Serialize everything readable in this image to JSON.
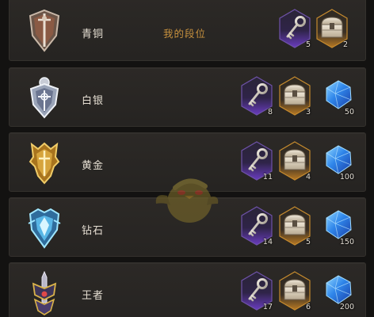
{
  "screen": {
    "my_tier_label": "我的段位"
  },
  "tiers": [
    {
      "name": "青铜",
      "emblem_icon": "bronze-shield-emblem",
      "rewards": [
        {
          "type": "key",
          "icon": "key-icon",
          "count": "5",
          "frame": "purple"
        },
        {
          "type": "chest",
          "icon": "chest-icon",
          "count": "2",
          "frame": "gold"
        }
      ]
    },
    {
      "name": "白银",
      "emblem_icon": "silver-shield-emblem",
      "rewards": [
        {
          "type": "key",
          "icon": "key-icon",
          "count": "8",
          "frame": "purple"
        },
        {
          "type": "chest",
          "icon": "chest-icon",
          "count": "3",
          "frame": "gold"
        },
        {
          "type": "gem",
          "icon": "blue-gem-icon",
          "count": "50",
          "frame": "none"
        }
      ]
    },
    {
      "name": "黄金",
      "emblem_icon": "gold-shield-emblem",
      "rewards": [
        {
          "type": "key",
          "icon": "key-icon",
          "count": "11",
          "frame": "purple"
        },
        {
          "type": "chest",
          "icon": "chest-icon",
          "count": "4",
          "frame": "gold"
        },
        {
          "type": "gem",
          "icon": "blue-gem-icon",
          "count": "100",
          "frame": "none"
        }
      ]
    },
    {
      "name": "钻石",
      "emblem_icon": "diamond-shield-emblem",
      "rewards": [
        {
          "type": "key",
          "icon": "key-icon",
          "count": "14",
          "frame": "purple"
        },
        {
          "type": "chest",
          "icon": "chest-icon",
          "count": "5",
          "frame": "gold"
        },
        {
          "type": "gem",
          "icon": "blue-gem-icon",
          "count": "150",
          "frame": "none"
        }
      ]
    },
    {
      "name": "王者",
      "emblem_icon": "king-sword-emblem",
      "rewards": [
        {
          "type": "key",
          "icon": "key-icon",
          "count": "17",
          "frame": "purple"
        },
        {
          "type": "chest",
          "icon": "chest-icon",
          "count": "6",
          "frame": "gold"
        },
        {
          "type": "gem",
          "icon": "blue-gem-icon",
          "count": "200",
          "frame": "none"
        }
      ]
    }
  ],
  "colors": {
    "row_background": "#2a2724",
    "tier_name_text": "#e5ded2",
    "my_tier_text": "#c7913e",
    "key_frame": "#4a2a78",
    "chest_frame": "#c58a2e",
    "gem": "#2f7de0"
  }
}
